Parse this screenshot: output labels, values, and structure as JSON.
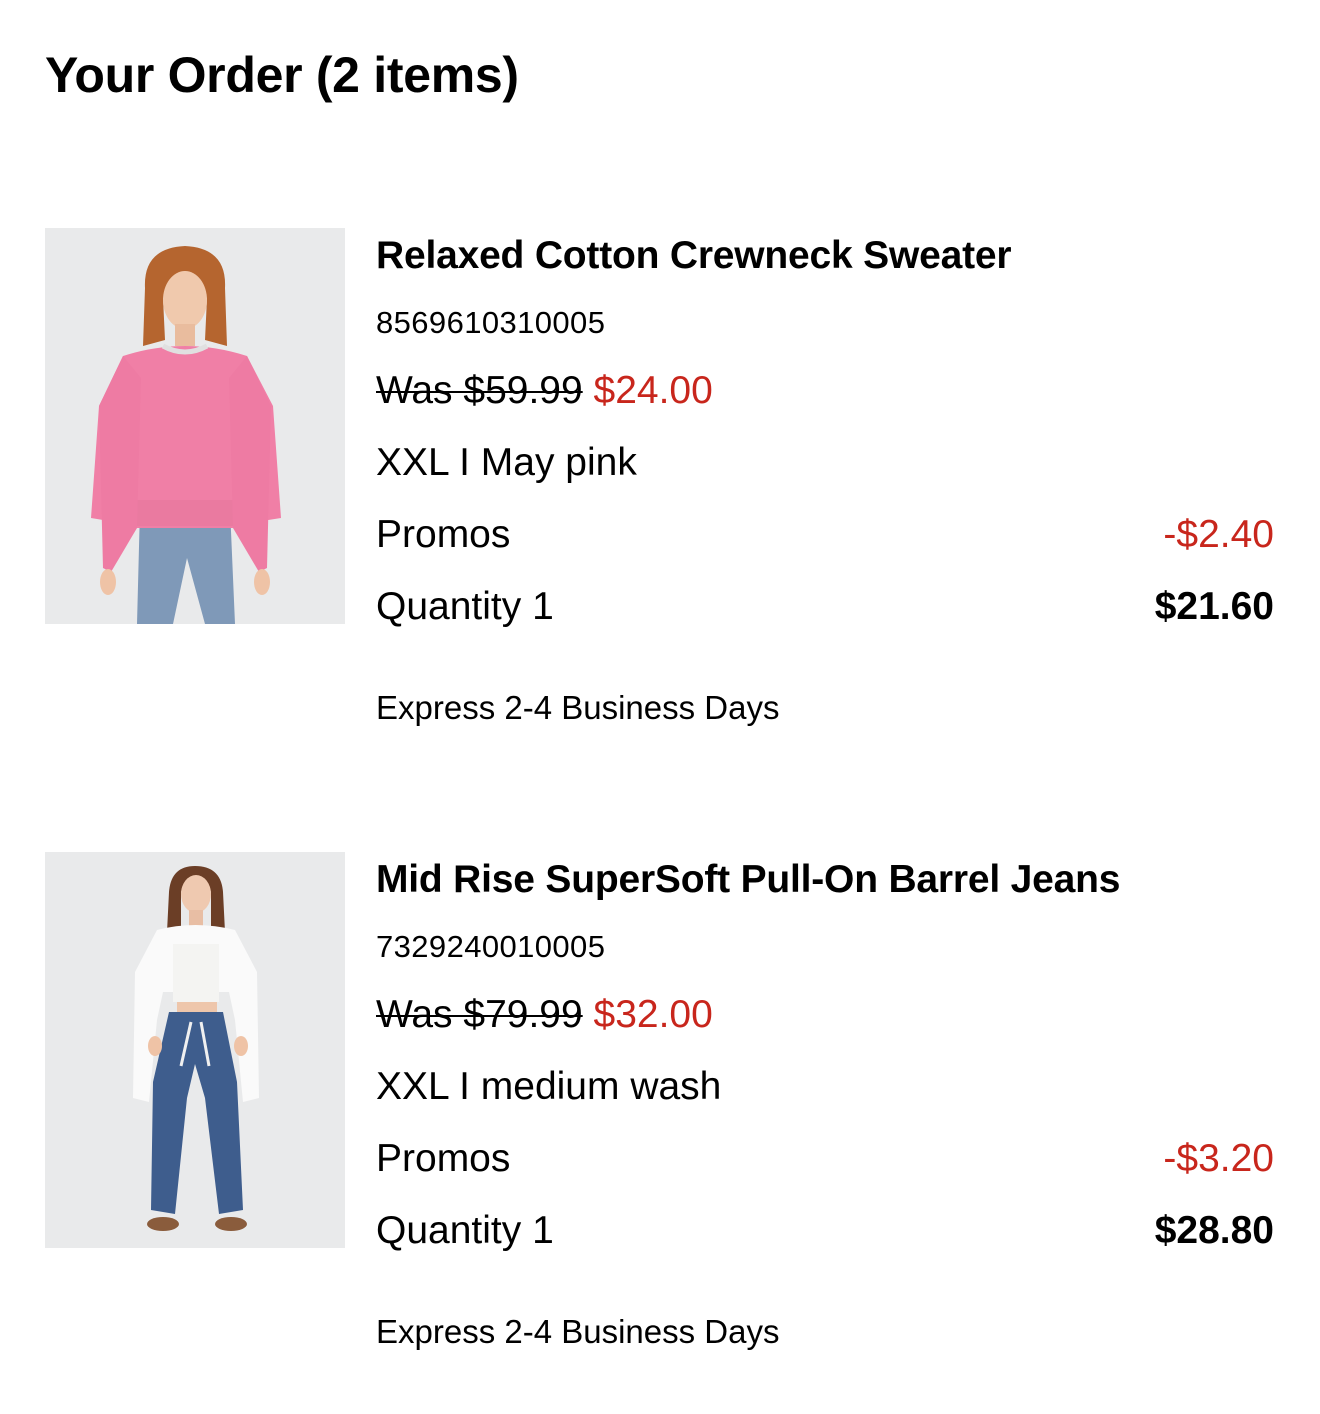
{
  "order": {
    "title": "Your Order (2 items)"
  },
  "items": [
    {
      "name": "Relaxed Cotton Crewneck Sweater",
      "sku": "8569610310005",
      "was_price": "Was $59.99",
      "sale_price": "$24.00",
      "variant": "XXL I May pink",
      "promos_label": "Promos",
      "promos_amount": "-$2.40",
      "quantity": "Quantity 1",
      "line_total": "$21.60",
      "shipping": "Express 2-4 Business Days"
    },
    {
      "name": "Mid Rise SuperSoft Pull-On Barrel Jeans",
      "sku": "7329240010005",
      "was_price": "Was $79.99",
      "sale_price": "$32.00",
      "variant": "XXL I medium wash",
      "promos_label": "Promos",
      "promos_amount": "-$3.20",
      "quantity": "Quantity 1",
      "line_total": "$28.80",
      "shipping": "Express 2-4 Business Days"
    }
  ],
  "colors": {
    "sale": "#c8261c",
    "text": "#000000",
    "image_bg": "#e9eaeb"
  }
}
